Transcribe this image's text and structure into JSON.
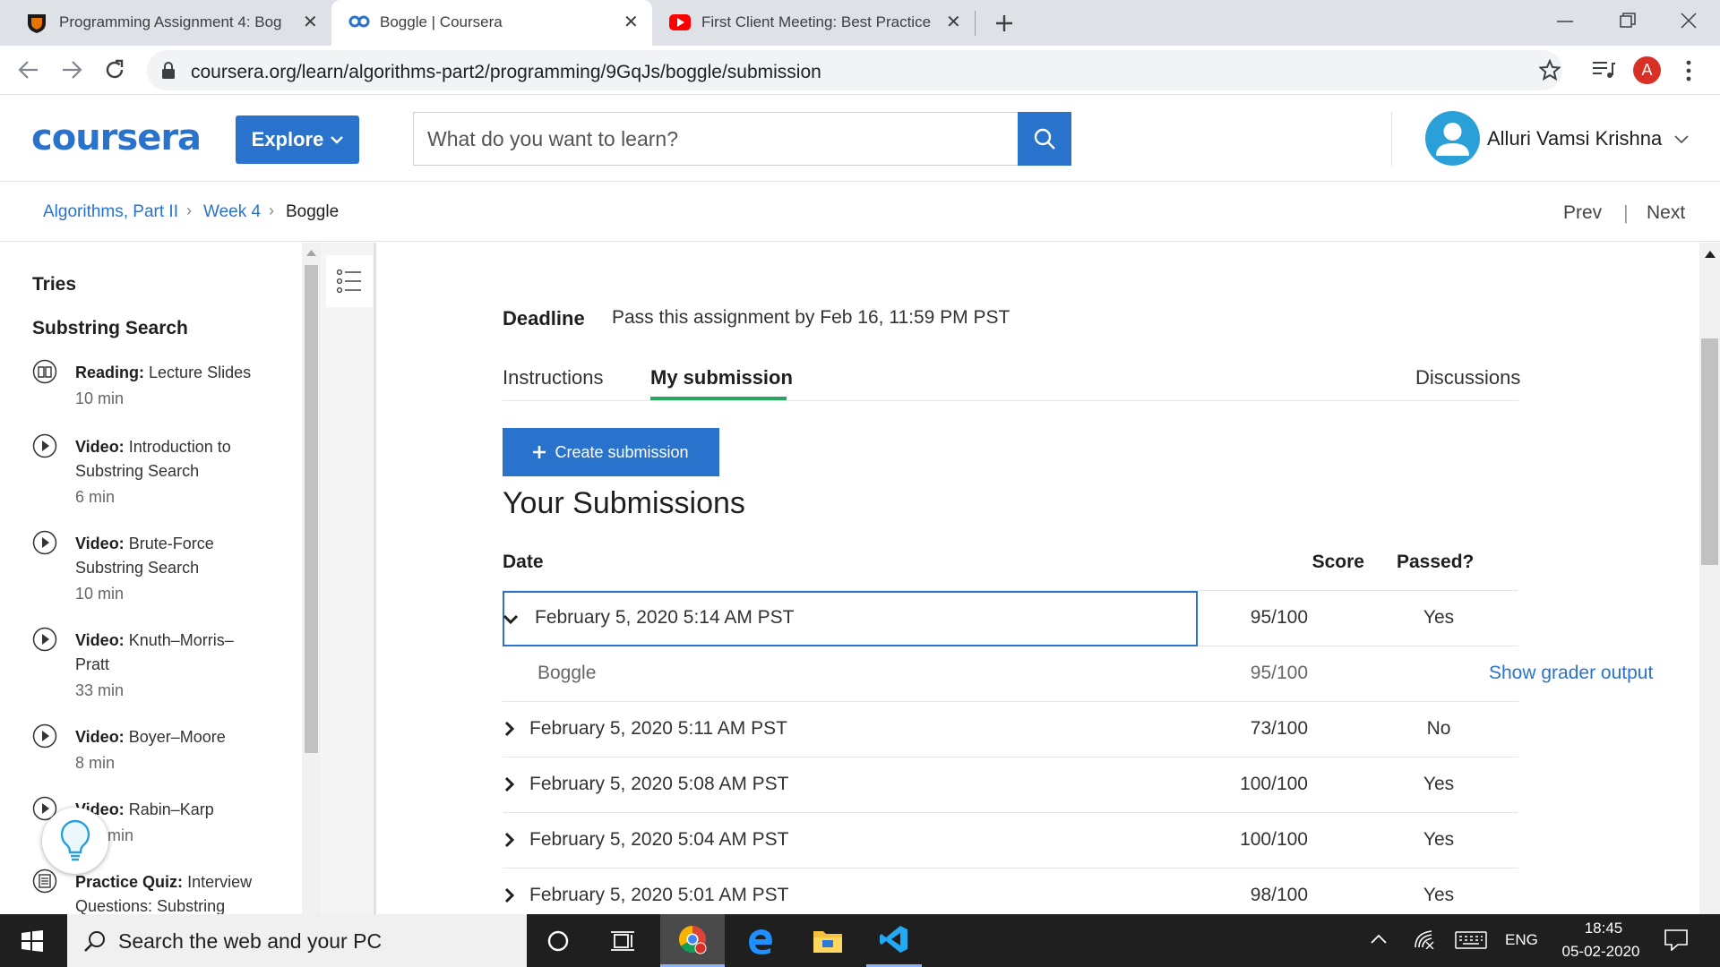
{
  "browser": {
    "tabs": [
      {
        "title": "Programming Assignment 4: Bog",
        "active": false
      },
      {
        "title": "Boggle | Coursera",
        "active": true
      },
      {
        "title": "First Client Meeting: Best Practice",
        "active": false
      }
    ],
    "url": "coursera.org/learn/algorithms-part2/programming/9GqJs/boggle/submission",
    "profile_initial": "A"
  },
  "header": {
    "logo": "coursera",
    "explore_label": "Explore",
    "search_placeholder": "What do you want to learn?",
    "user_name": "Alluri Vamsi Krishna",
    "colors": {
      "brand": "#2a73cc"
    }
  },
  "breadcrumb": {
    "items": [
      "Algorithms, Part II",
      "Week 4",
      "Boggle"
    ],
    "prev_label": "Prev",
    "next_label": "Next"
  },
  "sidebar": {
    "headings": [
      "Tries",
      "Substring Search"
    ],
    "items": [
      {
        "kind": "Reading:",
        "title": "Lecture Slides",
        "duration": "10 min",
        "icon": "book-icon"
      },
      {
        "kind": "Video:",
        "title": "Introduction to Substring Search",
        "duration": "6 min",
        "icon": "play-icon"
      },
      {
        "kind": "Video:",
        "title": "Brute-Force Substring Search",
        "duration": "10 min",
        "icon": "play-icon"
      },
      {
        "kind": "Video:",
        "title": "Knuth–Morris–Pratt",
        "duration": "33 min",
        "icon": "play-icon"
      },
      {
        "kind": "Video:",
        "title": "Boyer–Moore",
        "duration": "8 min",
        "icon": "play-icon"
      },
      {
        "kind": "Video:",
        "title": "Rabin–Karp",
        "duration": "min",
        "icon": "play-icon"
      },
      {
        "kind": "Practice Quiz:",
        "title": "Interview Questions: Substring",
        "duration": "",
        "icon": "quiz-icon"
      }
    ]
  },
  "main": {
    "deadline_label": "Deadline",
    "deadline_text": "Pass this assignment by Feb 16, 11:59 PM PST",
    "tabs": [
      {
        "label": "Instructions",
        "active": false
      },
      {
        "label": "My submission",
        "active": true
      },
      {
        "label": "Discussions",
        "active": false
      }
    ],
    "create_button": "Create submission",
    "submissions_title": "Your Submissions",
    "columns": [
      "Date",
      "Score",
      "Passed?"
    ],
    "submissions": [
      {
        "date": "February 5, 2020 5:14 AM PST",
        "score": "95/100",
        "passed": "Yes",
        "expanded": true,
        "parts": [
          {
            "name": "Boggle",
            "score": "95/100",
            "link": "Show grader output"
          }
        ]
      },
      {
        "date": "February 5, 2020 5:11 AM PST",
        "score": "73/100",
        "passed": "No",
        "expanded": false
      },
      {
        "date": "February 5, 2020 5:08 AM PST",
        "score": "100/100",
        "passed": "Yes",
        "expanded": false
      },
      {
        "date": "February 5, 2020 5:04 AM PST",
        "score": "100/100",
        "passed": "Yes",
        "expanded": false
      },
      {
        "date": "February 5, 2020 5:01 AM PST",
        "score": "98/100",
        "passed": "Yes",
        "expanded": false
      }
    ]
  },
  "taskbar": {
    "search_placeholder": "Search the web and your PC",
    "language": "ENG",
    "time": "18:45",
    "date": "05-02-2020"
  }
}
